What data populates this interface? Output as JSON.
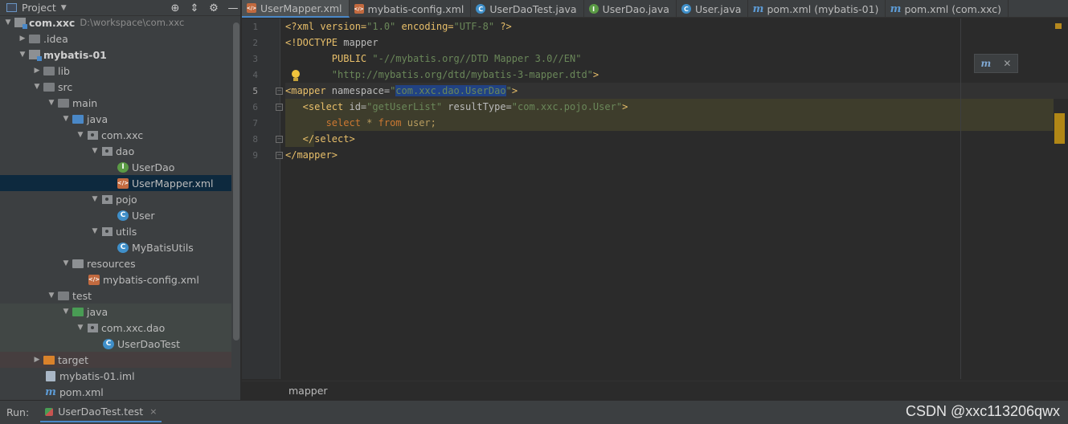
{
  "project_panel": {
    "title": "Project",
    "tools": [
      "target-icon",
      "collapse-icon",
      "gear-icon",
      "minimize-icon"
    ],
    "tree": [
      {
        "label": "com.xxc",
        "path": "D:\\workspace\\com.xxc",
        "bold": true
      },
      {
        "label": ".idea"
      },
      {
        "label": "mybatis-01",
        "bold": true
      },
      {
        "label": "lib"
      },
      {
        "label": "src"
      },
      {
        "label": "main"
      },
      {
        "label": "java"
      },
      {
        "label": "com.xxc"
      },
      {
        "label": "dao"
      },
      {
        "label": "UserDao"
      },
      {
        "label": "UserMapper.xml"
      },
      {
        "label": "pojo"
      },
      {
        "label": "User"
      },
      {
        "label": "utils"
      },
      {
        "label": "MyBatisUtils"
      },
      {
        "label": "resources"
      },
      {
        "label": "mybatis-config.xml"
      },
      {
        "label": "test"
      },
      {
        "label": "java"
      },
      {
        "label": "com.xxc.dao"
      },
      {
        "label": "UserDaoTest"
      },
      {
        "label": "target"
      },
      {
        "label": "mybatis-01.iml"
      },
      {
        "label": "pom.xml"
      }
    ]
  },
  "tabs": [
    {
      "label": "UserMapper.xml",
      "icon": "xml-file-icon",
      "active": true
    },
    {
      "label": "mybatis-config.xml",
      "icon": "xml-file-icon"
    },
    {
      "label": "UserDaoTest.java",
      "icon": "class-icon"
    },
    {
      "label": "UserDao.java",
      "icon": "interface-icon"
    },
    {
      "label": "User.java",
      "icon": "class-icon"
    },
    {
      "label": "pom.xml (mybatis-01)",
      "icon": "maven-icon"
    },
    {
      "label": "pom.xml (com.xxc)",
      "icon": "maven-icon"
    }
  ],
  "editor": {
    "line_numbers": [
      "1",
      "2",
      "3",
      "4",
      "5",
      "6",
      "7",
      "8",
      "9"
    ],
    "current_line": 5,
    "lines": {
      "l1": {
        "a": "<?xml version=",
        "b": "\"1.0\"",
        "c": " encoding=",
        "d": "\"UTF-8\"",
        "e": " ?>"
      },
      "l2": {
        "a": "<!DOCTYPE",
        "b": " mapper"
      },
      "l3": {
        "a": "        PUBLIC ",
        "b": "\"-//mybatis.org//DTD Mapper 3.0//EN\""
      },
      "l4": {
        "a": "        ",
        "b": "\"http://mybatis.org/dtd/mybatis-3-mapper.dtd\"",
        "c": ">"
      },
      "l5": {
        "a": "<mapper",
        "b": " namespace=",
        "c": "\"",
        "d": "com.xxc.dao.UserDao",
        "e": "\"",
        "f": ">"
      },
      "l6": {
        "a": "   <select",
        "b": " id=",
        "c": "\"getUserList\"",
        "d": " resultType=",
        "e": "\"com.xxc.pojo.User\"",
        "f": ">"
      },
      "l7": {
        "a": "       ",
        "b": "select",
        "c": " * ",
        "d": "from",
        "e": " user;"
      },
      "l8": {
        "a": "   </select>"
      },
      "l9": {
        "a": "</mapper>"
      }
    }
  },
  "breadcrumb": "mapper",
  "run_bar": {
    "label": "Run:",
    "tab_label": "UserDaoTest.test",
    "close": "×"
  },
  "watermark": "CSDN @xxc113206qwx"
}
